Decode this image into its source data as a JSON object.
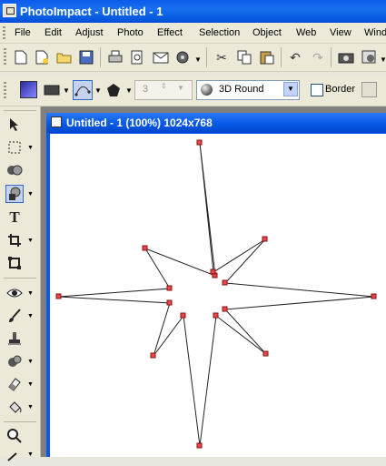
{
  "window": {
    "title": "PhotoImpact - Untitled - 1"
  },
  "menu": [
    "File",
    "Edit",
    "Adjust",
    "Photo",
    "Effect",
    "Selection",
    "Object",
    "Web",
    "View",
    "Windo"
  ],
  "toolbar1_icons": [
    "new-icon",
    "new-from-template-icon",
    "open-icon",
    "save-icon",
    "print-icon",
    "print-preview-icon",
    "mail-icon",
    "scan-icon",
    "cut-icon",
    "copy-icon",
    "paste-icon",
    "undo-icon",
    "redo-icon",
    "camera-icon",
    "capture-icon"
  ],
  "toolbar2": {
    "spin_value": "3",
    "mode_label": "3D Round",
    "border_label": "Border"
  },
  "left_tools": [
    "pick-tool-icon",
    "selection-tool-icon",
    "mask-tool-icon",
    "path-tool-icon",
    "text-tool-icon",
    "crop-tool-icon",
    "transform-tool-icon",
    "red-eye-tool-icon",
    "paint-tool-icon",
    "stamp-tool-icon",
    "clone-tool-icon",
    "eraser-tool-icon",
    "fill-tool-icon",
    "zoom-tool-icon",
    "eyedropper-tool-icon"
  ],
  "document": {
    "title": "Untitled - 1 (100%) 1024x768"
  }
}
